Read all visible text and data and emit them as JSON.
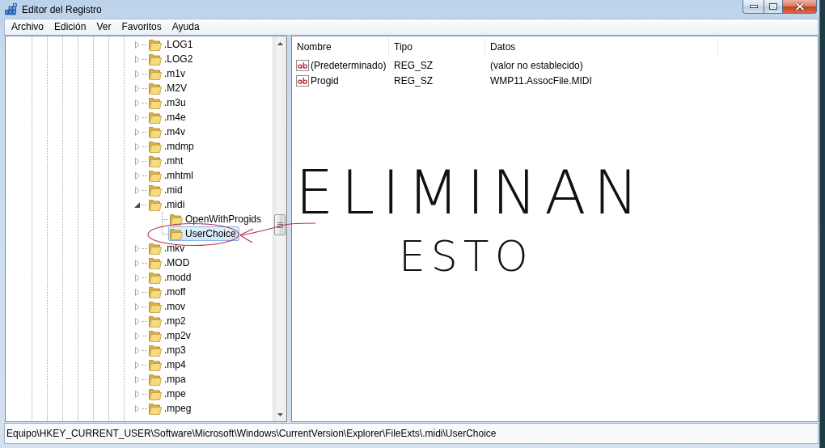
{
  "window": {
    "title": "Editor del Registro"
  },
  "menu_bar": [
    "Archivo",
    "Edición",
    "Ver",
    "Favoritos",
    "Ayuda"
  ],
  "tree": {
    "items": [
      {
        "label": ".LOG1",
        "expanded": false,
        "selected": false
      },
      {
        "label": ".LOG2",
        "expanded": false,
        "selected": false
      },
      {
        "label": ".m1v",
        "expanded": false,
        "selected": false
      },
      {
        "label": ".M2V",
        "expanded": false,
        "selected": false
      },
      {
        "label": ".m3u",
        "expanded": false,
        "selected": false
      },
      {
        "label": ".m4e",
        "expanded": false,
        "selected": false
      },
      {
        "label": ".m4v",
        "expanded": false,
        "selected": false
      },
      {
        "label": ".mdmp",
        "expanded": false,
        "selected": false
      },
      {
        "label": ".mht",
        "expanded": false,
        "selected": false
      },
      {
        "label": ".mhtml",
        "expanded": false,
        "selected": false
      },
      {
        "label": ".mid",
        "expanded": false,
        "selected": false
      },
      {
        "label": ".midi",
        "expanded": true,
        "selected": false,
        "children": [
          {
            "label": "OpenWithProgids",
            "selected": false
          },
          {
            "label": "UserChoice",
            "selected": true
          }
        ]
      },
      {
        "label": ".mkv",
        "expanded": false,
        "selected": false
      },
      {
        "label": ".MOD",
        "expanded": false,
        "selected": false
      },
      {
        "label": ".modd",
        "expanded": false,
        "selected": false
      },
      {
        "label": ".moff",
        "expanded": false,
        "selected": false
      },
      {
        "label": ".mov",
        "expanded": false,
        "selected": false
      },
      {
        "label": ".mp2",
        "expanded": false,
        "selected": false
      },
      {
        "label": ".mp2v",
        "expanded": false,
        "selected": false
      },
      {
        "label": ".mp3",
        "expanded": false,
        "selected": false
      },
      {
        "label": ".mp4",
        "expanded": false,
        "selected": false
      },
      {
        "label": ".mpa",
        "expanded": false,
        "selected": false
      },
      {
        "label": ".mpe",
        "expanded": false,
        "selected": false
      },
      {
        "label": ".mpeg",
        "expanded": false,
        "selected": false
      }
    ]
  },
  "values": {
    "columns": [
      "Nombre",
      "Tipo",
      "Datos"
    ],
    "rows": [
      {
        "name": "(Predeterminado)",
        "type": "REG_SZ",
        "data": "(valor no establecido)"
      },
      {
        "name": "Progid",
        "type": "REG_SZ",
        "data": "WMP11.AssocFile.MIDI"
      }
    ]
  },
  "annotation": {
    "lines": [
      "ELIMINAN",
      "ESTO"
    ]
  },
  "status_bar": {
    "path": "Equipo\\HKEY_CURRENT_USER\\Software\\Microsoft\\Windows\\CurrentVersion\\Explorer\\FileExts\\.midi\\UserChoice"
  }
}
